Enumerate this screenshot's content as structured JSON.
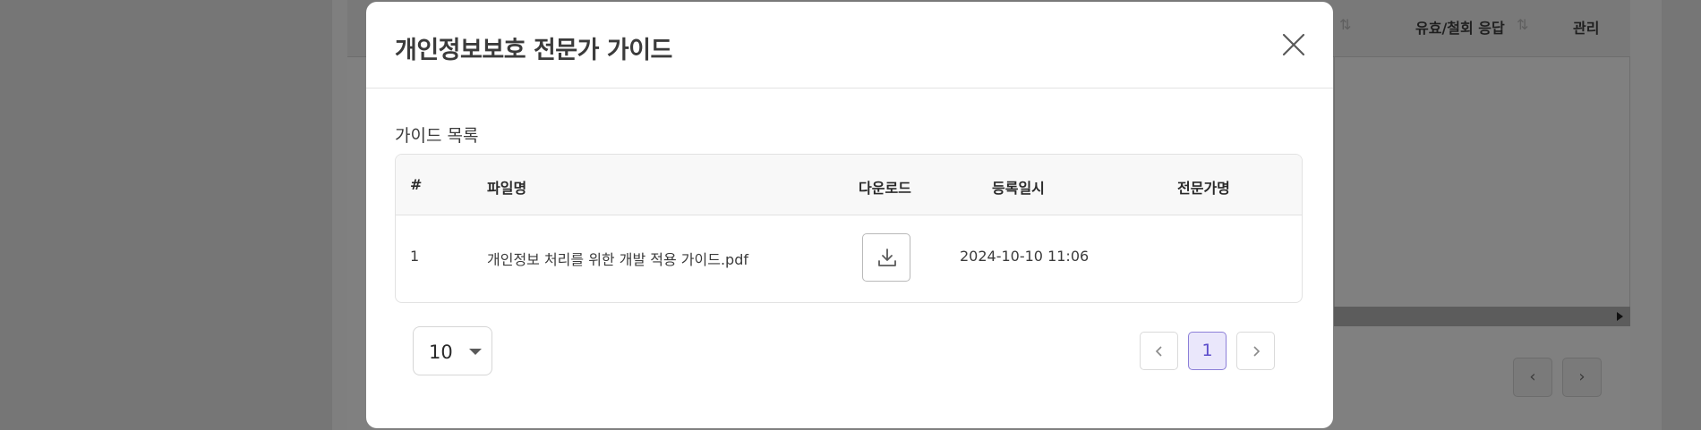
{
  "background": {
    "columns": [
      {
        "label": "유효/철회 응답"
      },
      {
        "label": "관리"
      }
    ],
    "sort_icon": "sort-arrows-icon"
  },
  "modal": {
    "title": "개인정보보호 전문가 가이드",
    "close_icon": "close-icon",
    "section_label": "가이드 목록",
    "table": {
      "headers": [
        "#",
        "파일명",
        "다운로드",
        "등록일시",
        "전문가명"
      ],
      "rows": [
        {
          "no": "1",
          "file_name": "개인정보 처리를 위한 개발 적용 가이드.pdf",
          "download_icon": "download-icon",
          "registered_at": "2024-10-10 11:06",
          "expert_name": ""
        }
      ]
    },
    "pagination": {
      "page_size": "10",
      "current_page": "1"
    }
  },
  "colors": {
    "accent": "#5b4ccb",
    "accent_bg": "#eae7fb",
    "overlay": "#767676"
  }
}
